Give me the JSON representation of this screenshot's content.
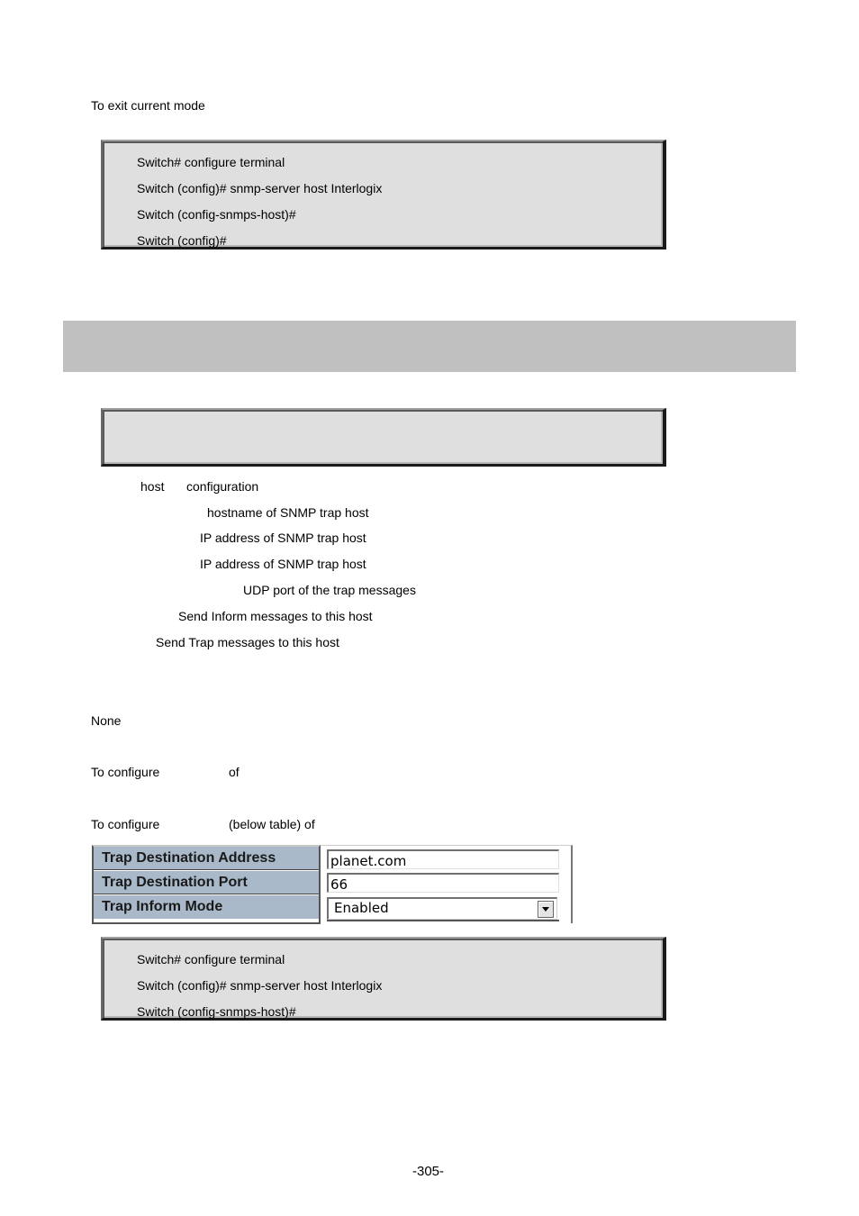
{
  "exit_section": {
    "description": "To exit current mode",
    "example_lines": [
      "Switch# configure terminal",
      "Switch (config)# snmp-server host Interlogix",
      "Switch (config-snmps-host)#",
      "Switch (config)#"
    ]
  },
  "heading": "",
  "syntax_box": [],
  "parameters": [
    {
      "term": "host",
      "description": "configuration"
    },
    {
      "term": "",
      "description": "hostname of SNMP trap host"
    },
    {
      "term": "",
      "description": "IP address of SNMP trap host"
    },
    {
      "term": "",
      "description": "IP address of SNMP trap host"
    },
    {
      "term": "",
      "description": "UDP port of the trap messages"
    },
    {
      "term": "",
      "description": "Send Inform messages to this host"
    },
    {
      "term": "",
      "description": "Send Trap messages to this host"
    }
  ],
  "default": "None",
  "usage": [
    {
      "prefix": "To configure",
      "suffix": "of"
    },
    {
      "prefix": "To configure",
      "suffix": "(below table) of"
    }
  ],
  "config_table": {
    "rows": [
      {
        "label": "Trap Destination Address",
        "value": "planet.com",
        "type": "text"
      },
      {
        "label": "Trap Destination Port",
        "value": "66",
        "type": "text"
      },
      {
        "label": "Trap Inform Mode",
        "value": "Enabled",
        "type": "select"
      }
    ]
  },
  "example_section": {
    "lines": [
      "Switch# configure terminal",
      "Switch (config)# snmp-server host Interlogix",
      "Switch (config-snmps-host)#"
    ]
  },
  "page_number": "-305-"
}
